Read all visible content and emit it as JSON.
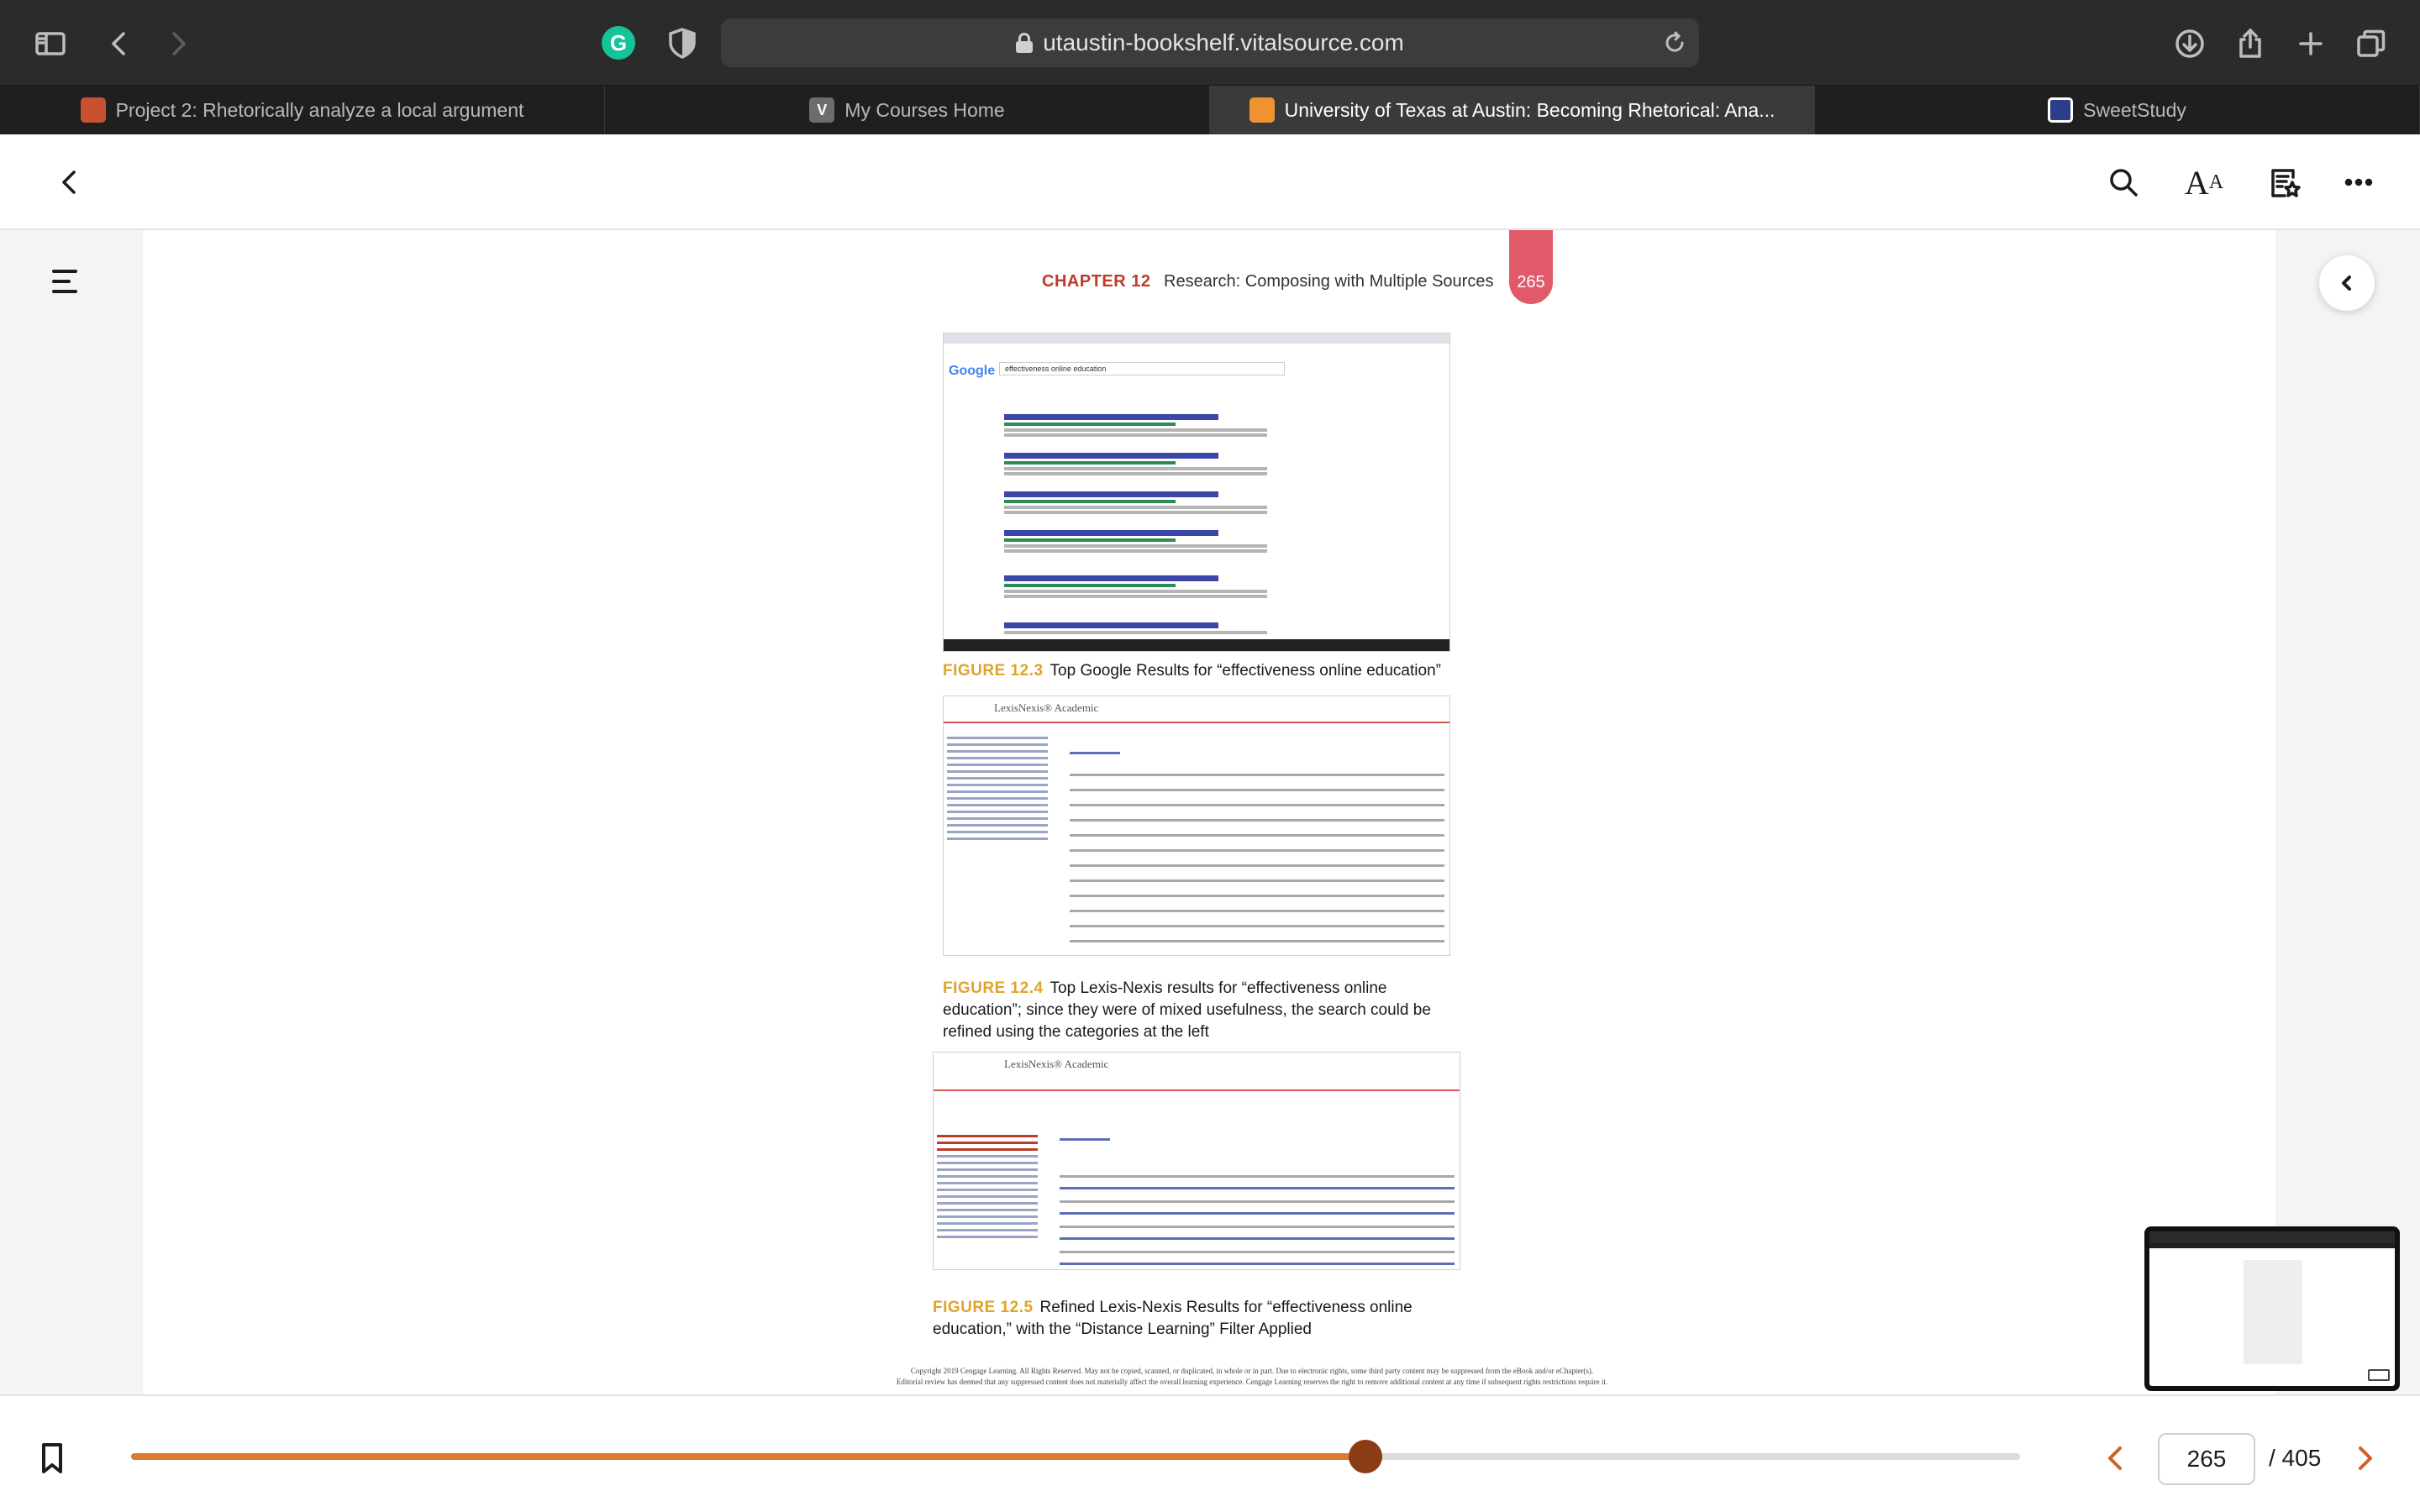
{
  "browser": {
    "url": "utaustin-bookshelf.vitalsource.com",
    "tabs": [
      {
        "label": "Project 2: Rhetorically analyze a local argument",
        "favicon": "",
        "active": false
      },
      {
        "label": "My Courses Home",
        "favicon": "V",
        "active": false
      },
      {
        "label": "University of Texas at Austin: Becoming Rhetorical: Ana...",
        "favicon": "",
        "active": true
      },
      {
        "label": "SweetStudy",
        "favicon": "",
        "active": false
      }
    ],
    "extension_letter": "G"
  },
  "reader": {
    "page_tab_number": "265",
    "running_head": {
      "chapter": "CHAPTER 12",
      "title": "Research: Composing with Multiple Sources"
    },
    "figures": [
      {
        "number": "FIGURE 12.3",
        "caption": "Top Google Results for “effectiveness online education”"
      },
      {
        "number": "FIGURE 12.4",
        "caption": "Top Lexis-Nexis results for “effectiveness online education”; since they were of mixed usefulness, the search could be refined using the categories at the left"
      },
      {
        "number": "FIGURE 12.5",
        "caption": "Refined Lexis-Nexis Results for “effectiveness online education,” with the “Distance Learning” Filter Applied"
      }
    ],
    "screenshot_text": {
      "google_logo": "Google",
      "google_query": "effectiveness online education",
      "lexis_logo_1": "LexisNexis® Academic",
      "lexis_logo_2": "LexisNexis® Academic"
    },
    "copyright_line_1": "Copyright 2019 Cengage Learning. All Rights Reserved. May not be copied, scanned, or duplicated, in whole or in part. Due to electronic rights, some third party content may be suppressed from the eBook and/or eChapter(s).",
    "copyright_line_2": "Editorial review has deemed that any suppressed content does not materially affect the overall learning experience. Cengage Learning reserves the right to remove additional content at any time if subsequent rights restrictions require it."
  },
  "footer": {
    "progress_fraction": 0.6536,
    "current_page": "265",
    "total_pages": "/ 405"
  },
  "colors": {
    "accent": "#e07a2e",
    "progress_thumb": "#8a3d12",
    "chapter_red": "#c0392b",
    "figure_label": "#e0a32b",
    "page_tab": "#e05a6a"
  },
  "icons": [
    "sidebar-icon",
    "back-icon",
    "forward-icon",
    "shield-icon",
    "lock-icon",
    "reload-icon",
    "download-icon",
    "share-icon",
    "new-tab-icon",
    "tabs-overview-icon",
    "close-book-icon",
    "search-icon",
    "font-size-icon",
    "bookmarks-list-icon",
    "more-icon",
    "menu-icon",
    "collapse-panel-icon",
    "bookmark-icon",
    "prev-page-icon",
    "next-page-icon"
  ]
}
